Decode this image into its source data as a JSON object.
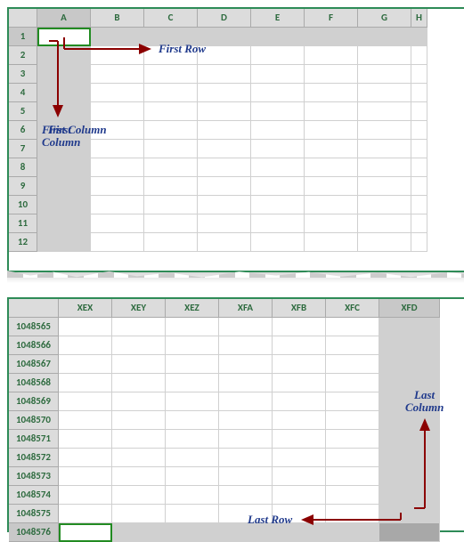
{
  "domain": "Document",
  "top": {
    "columns": [
      "A",
      "B",
      "C",
      "D",
      "E",
      "F",
      "G",
      "H"
    ],
    "rows": [
      "1",
      "2",
      "3",
      "4",
      "5",
      "6",
      "7",
      "8",
      "9",
      "10",
      "11",
      "12"
    ],
    "activeCell": "A1",
    "highlightRow": 0,
    "highlightCol": 0
  },
  "bottom": {
    "columns": [
      "XEX",
      "XEY",
      "XEZ",
      "XFA",
      "XFB",
      "XFC",
      "XFD"
    ],
    "rows": [
      "1048565",
      "1048566",
      "1048567",
      "1048568",
      "1048569",
      "1048570",
      "1048571",
      "1048572",
      "1048573",
      "1048574",
      "1048575",
      "1048576"
    ],
    "activeCell": "XEX1048576",
    "highlightRow": 11,
    "highlightCol": 6
  },
  "annotations": {
    "firstRow": "First Row",
    "firstColumn": "First Column",
    "lastRow": "Last Row",
    "lastColumn": "Last Column"
  },
  "chart_data": null
}
